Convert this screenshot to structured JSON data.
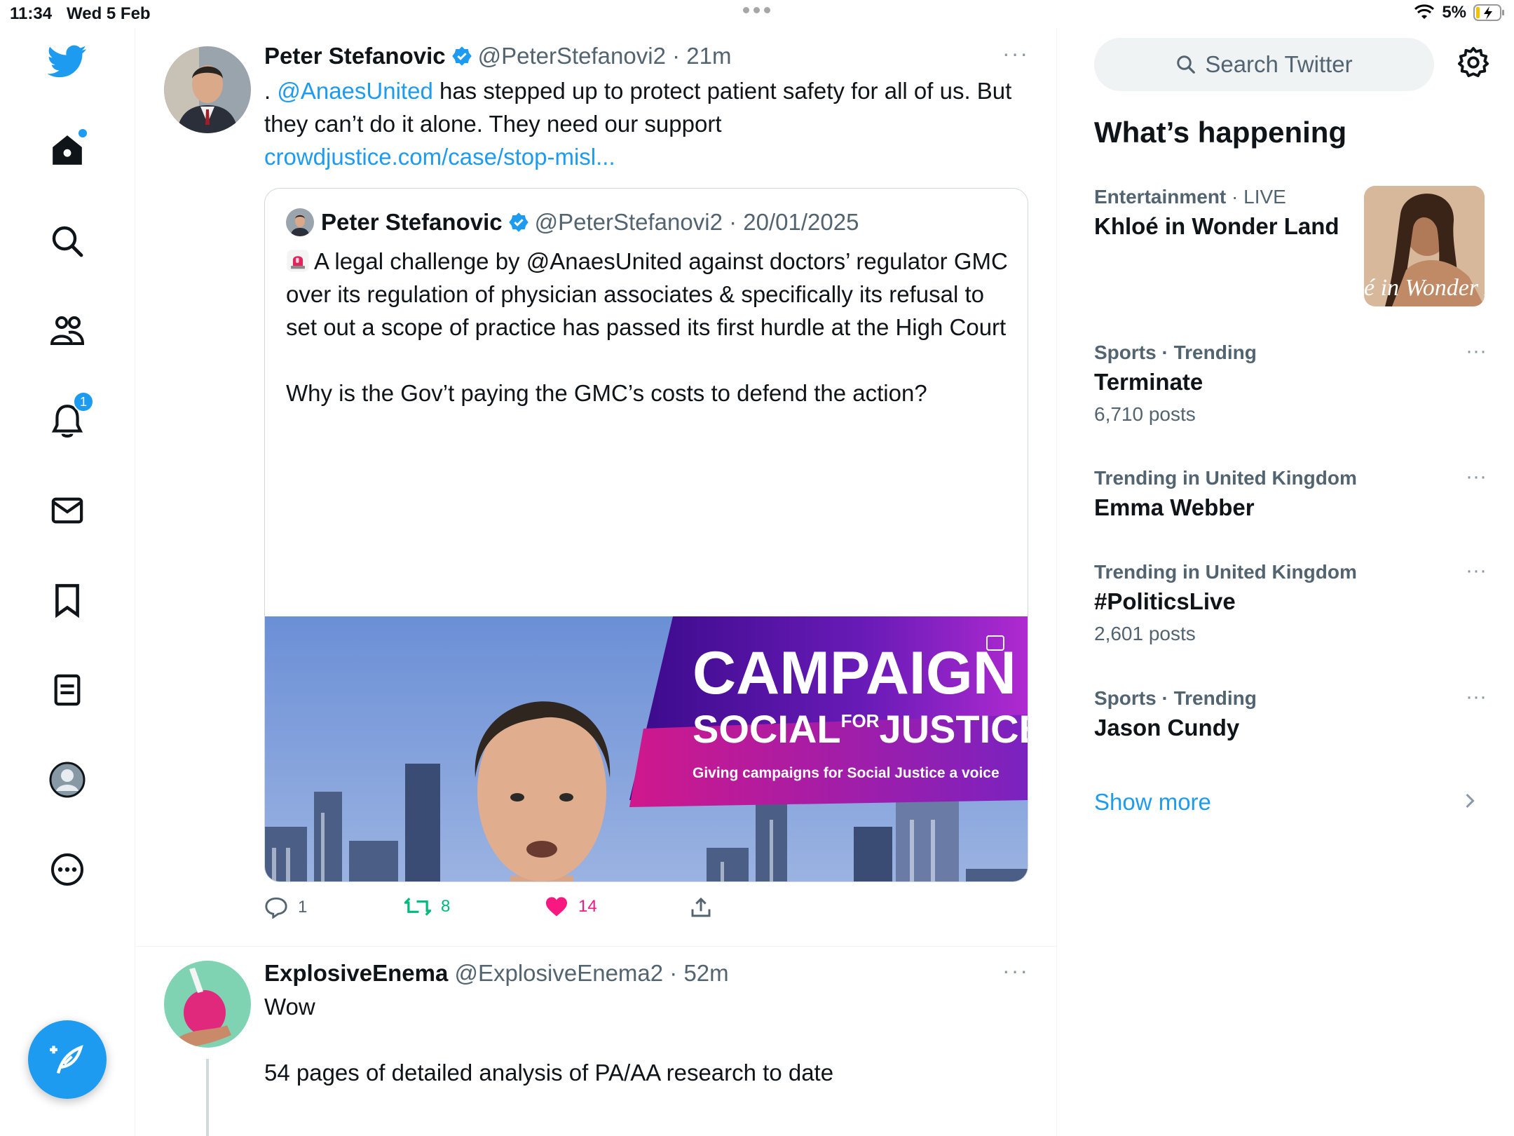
{
  "status": {
    "time": "11:34",
    "date": "Wed 5 Feb",
    "battery": "5%"
  },
  "nav": {
    "notifications_badge": "1"
  },
  "tweets": [
    {
      "name": "Peter Stefanovic",
      "handle": "@PeterStefanovi2",
      "time": "21m",
      "text_prefix": ". ",
      "mention": "@AnaesUnited",
      "text_main": " has stepped up to protect patient safety for all of us. But they can’t do it alone. They need our support",
      "link": "crowdjustice.com/case/stop-misl...",
      "quote": {
        "name": "Peter Stefanovic",
        "handle": "@PeterStefanovi2",
        "date": "20/01/2025",
        "text_p1": "A legal challenge by @AnaesUnited against doctors’ regulator GMC over its regulation of physician associates & specifically its refusal to set out a scope of practice has passed its first hurdle at the High Court",
        "text_p2": "Why is the Gov’t paying the GMC’s costs to defend the action?",
        "media": {
          "banner_title": "CAMPAIGN",
          "banner_social": "SOCIAL",
          "banner_for": "FOR",
          "banner_justice": "JUSTICE",
          "banner_tagline": "Giving campaigns for Social Justice a voice"
        }
      },
      "actions": {
        "replies": "1",
        "retweets": "8",
        "likes": "14"
      }
    },
    {
      "name": "ExplosiveEnema",
      "handle": "@ExplosiveEnema2",
      "time": "52m",
      "line1": "Wow",
      "line2": "54 pages of detailed analysis of PA/AA research to date"
    }
  ],
  "sidebar": {
    "search_placeholder": "Search Twitter",
    "section_title": "What’s happening",
    "trends": [
      {
        "category": "Entertainment",
        "extra": "LIVE",
        "name": "Khloé in Wonder Land",
        "count": "",
        "image_text": "é in Wonder L"
      },
      {
        "category": "Sports",
        "extra": "Trending",
        "name": "Terminate",
        "count": "6,710 posts"
      },
      {
        "category": "Trending in United Kingdom",
        "extra": "",
        "name": "Emma Webber",
        "count": ""
      },
      {
        "category": "Trending in United Kingdom",
        "extra": "",
        "name": "#PoliticsLive",
        "count": "2,601 posts"
      },
      {
        "category": "Sports",
        "extra": "Trending",
        "name": "Jason Cundy",
        "count": ""
      }
    ],
    "show_more": "Show more"
  },
  "colors": {
    "accent": "#1d9bf0",
    "retweet": "#00ba7c",
    "like": "#f91880",
    "muted": "#536471"
  }
}
